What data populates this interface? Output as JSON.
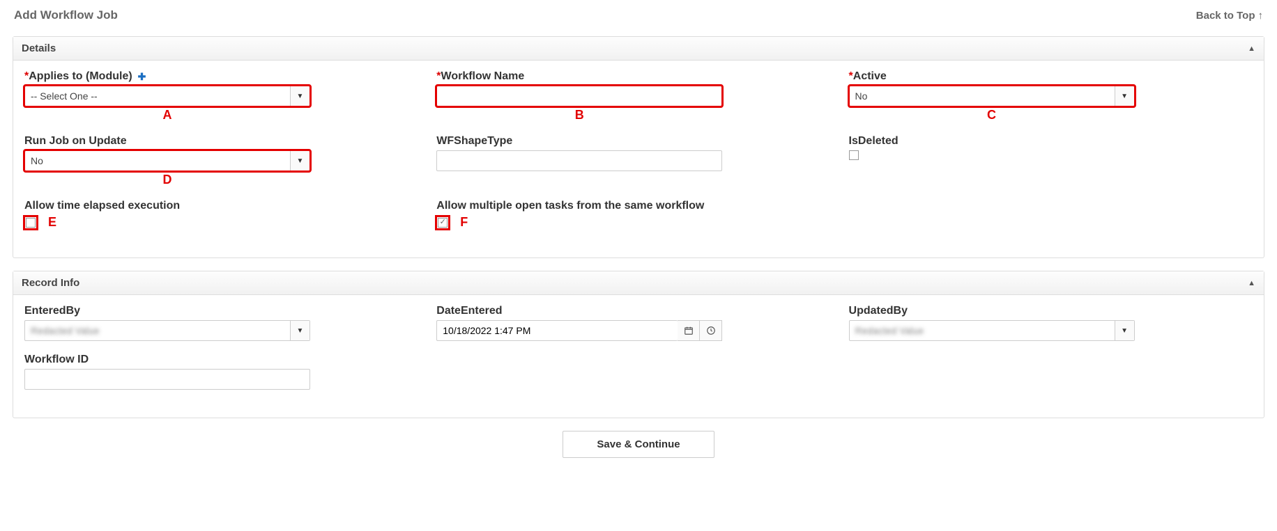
{
  "header": {
    "title": "Add Workflow Job",
    "back_to_top": "Back to Top"
  },
  "details": {
    "title": "Details",
    "applies_to": {
      "label": "Applies to (Module)",
      "value": "-- Select One --",
      "annot": "A"
    },
    "workflow_name": {
      "label": "Workflow Name",
      "value": "",
      "annot": "B"
    },
    "active": {
      "label": "Active",
      "value": "No",
      "annot": "C"
    },
    "run_on_update": {
      "label": "Run Job on Update",
      "value": "No",
      "annot": "D"
    },
    "wfshapetype": {
      "label": "WFShapeType",
      "value": ""
    },
    "isdeleted": {
      "label": "IsDeleted",
      "checked": false
    },
    "allow_elapsed": {
      "label": "Allow time elapsed execution",
      "checked": false,
      "annot": "E"
    },
    "allow_multiple": {
      "label": "Allow multiple open tasks from the same workflow",
      "checked": true,
      "annot": "F"
    }
  },
  "record": {
    "title": "Record Info",
    "entered_by": {
      "label": "EnteredBy",
      "value": ""
    },
    "date_entered": {
      "label": "DateEntered",
      "value": "10/18/2022 1:47 PM"
    },
    "updated_by": {
      "label": "UpdatedBy",
      "value": ""
    },
    "workflow_id": {
      "label": "Workflow ID",
      "value": ""
    }
  },
  "actions": {
    "save_continue": "Save & Continue"
  }
}
